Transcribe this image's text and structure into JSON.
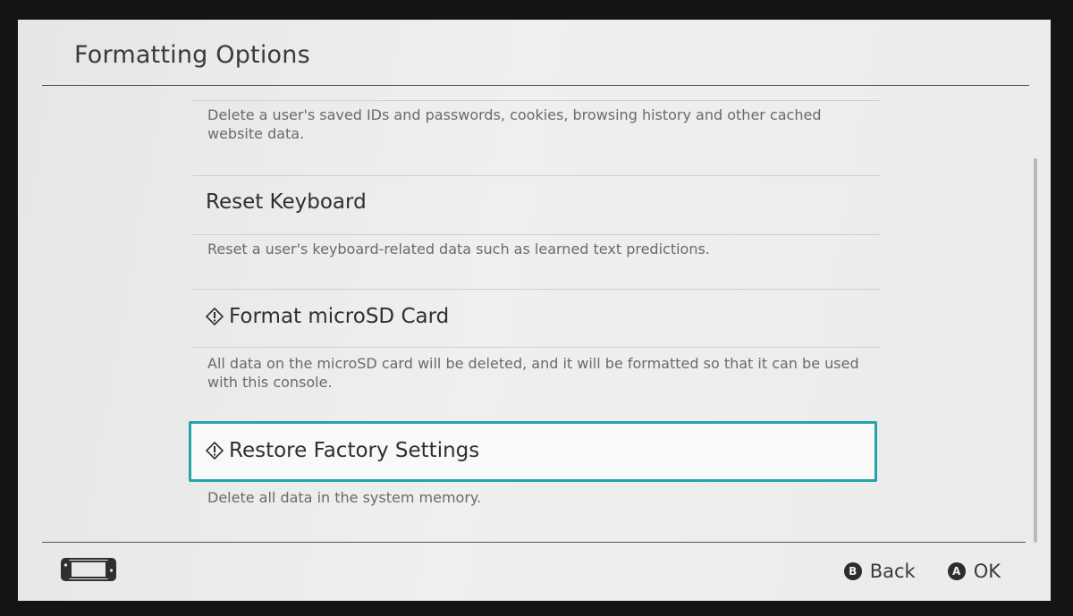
{
  "header": {
    "title": "Formatting Options"
  },
  "items": [
    {
      "title": "",
      "description": "Delete a user's saved IDs and passwords, cookies, browsing history and other cached website data."
    },
    {
      "title": "Reset Keyboard",
      "description": "Reset a user's keyboard-related data such as learned text predictions.",
      "warning": false
    },
    {
      "title": "Format microSD Card",
      "description": "All data on the microSD card will be deleted, and it will be formatted so that it can be used with this console.",
      "warning": true
    },
    {
      "title": "Restore Factory Settings",
      "description": "Delete all data in the system memory.",
      "warning": true,
      "selected": true
    }
  ],
  "footer": {
    "back": {
      "button": "B",
      "label": "Back"
    },
    "ok": {
      "button": "A",
      "label": "OK"
    }
  },
  "colors": {
    "selection": "#25a3ab",
    "background": "#ebebeb"
  },
  "icons": {
    "warning": "warning-diamond-icon",
    "console": "console-handheld-icon"
  }
}
